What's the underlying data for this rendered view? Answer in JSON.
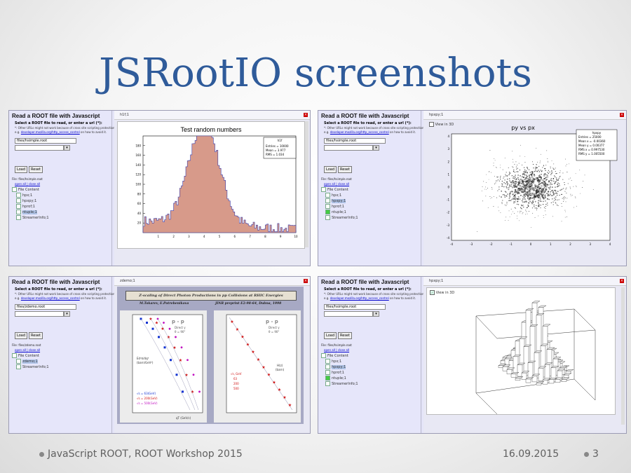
{
  "slide": {
    "title": "JSRootIO screenshots",
    "footer_left": "JavaScript ROOT, ROOT Workshop 2015",
    "footer_date": "16.09.2015",
    "page_number": "3",
    "title_color": "#2f5b9a"
  },
  "sidebar": {
    "heading": "Read a ROOT file with Javascript",
    "subheading": "Select a ROOT file to read, or enter a url (*):",
    "note": "*: Other URLs might not work because of cross site scripting protection, see",
    "note2_prefix": "e.g.",
    "note_link": "developer.mozilla.org/http_access_control",
    "note2_suffix": "on how to avoid it.",
    "load_label": "Load",
    "reset_label": "Reset",
    "open_all": "open all",
    "close_all": "close all",
    "file_content": "File Content",
    "streamer": "StreamerInfo;1"
  },
  "panels": [
    {
      "file_value": "files/hsimple.root",
      "file_label": "File: files/hsimple.root",
      "items": [
        "hpx;1",
        "hpxpy;1",
        "hprof;1",
        "ntuple;1"
      ],
      "window_title": "h1f;1",
      "plot_title": "Test random numbers",
      "stats": [
        "h1f",
        "Entries = 10000",
        "Mean = 3.977",
        "RMS = 1.034"
      ]
    },
    {
      "file_value": "files/hsimple.root",
      "file_label": "File: files/hsimple.root",
      "items": [
        "hpx;1",
        "hpxpy;1",
        "hprof;1",
        "ntuple;1"
      ],
      "window_title": "hpxpy;1",
      "view3d": "View in 3D",
      "plot_title": "py vs px",
      "stats": [
        "hpxpy",
        "Entries = 25000",
        "Mean x = -0.00360",
        "Mean y = 0.00377",
        "RMS x = 0.997530",
        "RMS y = 1.005500"
      ]
    },
    {
      "file_value": "files/zdemo.root",
      "file_label": "File: files/zdemo.root",
      "items": [
        "zdemo;1"
      ],
      "window_title": "zdemo;1",
      "paper_title": "Z-scaling of Direct Photon Productions in pp Collisions at RHIC Energies",
      "authors": "M.Tokarev, E.Potrebenikova",
      "preprint": "JINR preprint E2-98-64, Dubna, 1998",
      "pp_label": "p - p",
      "direct": "Direct γ",
      "theta": "θ = 90°",
      "ylabel_left": "Ed³σ/dq³",
      "ylabel_left_unit": "(barn/GeV²)",
      "ylabel_right": "H(z)",
      "ylabel_right_unit": "(barn)",
      "xlabel": "qT (GeV/c)",
      "legend_left": [
        "√s = 63(GeV)",
        "√s = 200(GeV)",
        "√s = 500(GeV)"
      ],
      "legend_right": [
        "√s, GeV",
        "63",
        "200",
        "500"
      ]
    },
    {
      "file_value": "files/hsimple.root",
      "file_label": "File: files/hsimple.root",
      "items": [
        "hpx;1",
        "hpxpy;1",
        "hprof;1",
        "ntuple;1"
      ],
      "window_title": "hpxpy;1",
      "view3d": "View in 3D"
    }
  ]
}
